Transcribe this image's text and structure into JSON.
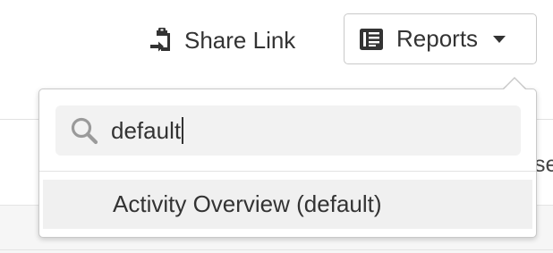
{
  "background": {
    "partial_text": "se"
  },
  "toolbar": {
    "share_link": {
      "label": "Share Link",
      "icon": "clipboard-share-icon"
    },
    "reports": {
      "label": "Reports",
      "icon": "report-document-icon",
      "chevron": "chevron-down-icon"
    }
  },
  "dropdown": {
    "search": {
      "value": "default",
      "icon": "search-icon"
    },
    "options": [
      {
        "label": "Activity Overview (default)",
        "highlighted": true
      }
    ]
  },
  "colors": {
    "text": "#333333",
    "border": "#c9c9c9",
    "search_bg": "#f2f2f2",
    "option_highlight": "#f0f0f0",
    "icon_gray": "#9a9a9a"
  }
}
